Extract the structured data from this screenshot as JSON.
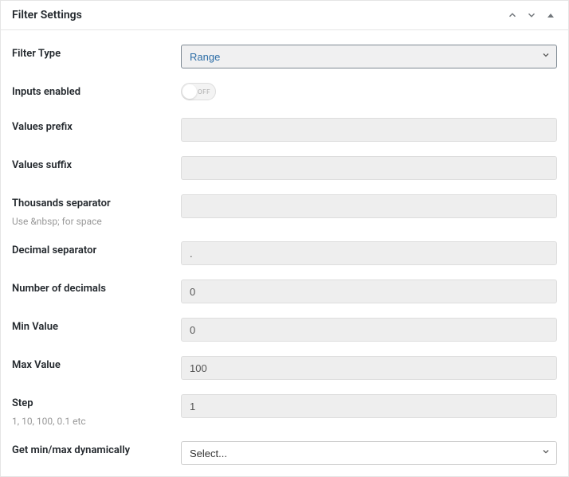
{
  "panel": {
    "title": "Filter Settings"
  },
  "fields": {
    "filter_type": {
      "label": "Filter Type",
      "value": "Range"
    },
    "inputs_enabled": {
      "label": "Inputs enabled",
      "state_text": "OFF"
    },
    "values_prefix": {
      "label": "Values prefix",
      "value": ""
    },
    "values_suffix": {
      "label": "Values suffix",
      "value": ""
    },
    "thousands_separator": {
      "label": "Thousands separator",
      "hint": "Use &nbsp; for space",
      "value": ""
    },
    "decimal_separator": {
      "label": "Decimal separator",
      "value": "."
    },
    "number_of_decimals": {
      "label": "Number of decimals",
      "value": "0"
    },
    "min_value": {
      "label": "Min Value",
      "value": "0"
    },
    "max_value": {
      "label": "Max Value",
      "value": "100"
    },
    "step": {
      "label": "Step",
      "hint": "1, 10, 100, 0.1 etc",
      "value": "1"
    },
    "get_min_max_dynamically": {
      "label": "Get min/max dynamically",
      "value": "Select..."
    }
  }
}
